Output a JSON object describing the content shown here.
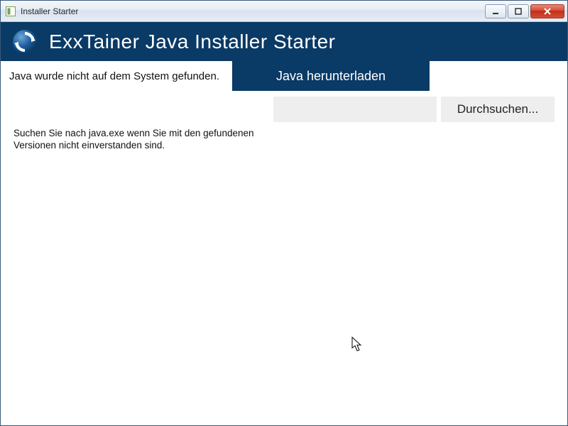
{
  "window": {
    "title": "Installer Starter"
  },
  "header": {
    "title": "ExxTainer Java Installer Starter"
  },
  "status": {
    "message": "Java wurde nicht auf dem System gefunden."
  },
  "buttons": {
    "download": "Java herunterladen",
    "browse": "Durchsuchen..."
  },
  "path_input": {
    "value": "",
    "placeholder": ""
  },
  "help": {
    "text": "Suchen Sie nach java.exe wenn Sie mit den gefundenen Versionen nicht einverstanden sind."
  },
  "colors": {
    "brand_dark_blue": "#0a3a66",
    "titlebar_close_red": "#c22f18",
    "grey_button": "#eeeeee"
  }
}
